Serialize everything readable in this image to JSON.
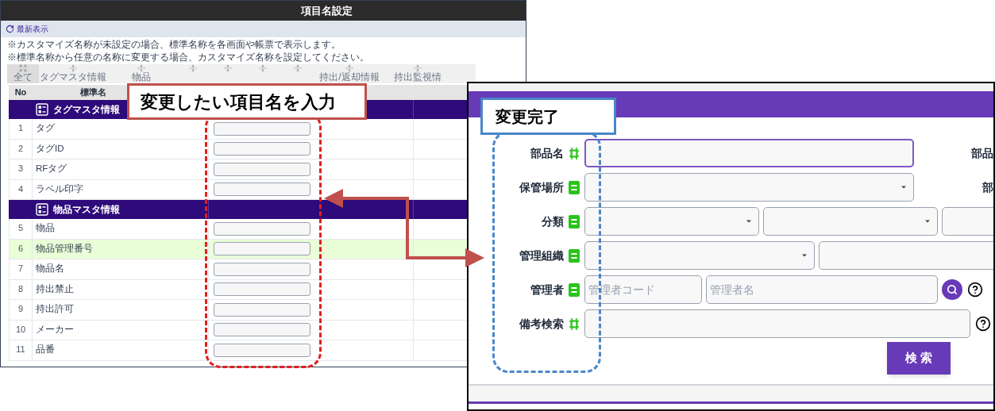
{
  "left_window": {
    "title": "項目名設定",
    "refresh": "最新表示",
    "notes": [
      "※カスタマイズ名称が未設定の場合、標準名称を各画面や帳票で表示します。",
      "※標準名称から任意の名称に変更する場合、カスタマイズ名称を設定してください。"
    ],
    "toolbar": [
      {
        "kind": "all",
        "label": "全て",
        "selected": true
      },
      {
        "kind": "section",
        "label": "タグマスタ情報",
        "selected": false
      },
      {
        "kind": "section",
        "label": "物品",
        "selected": false
      },
      {
        "kind": "section",
        "selected": false
      },
      {
        "kind": "section",
        "selected": false
      },
      {
        "kind": "section",
        "selected": false
      },
      {
        "kind": "section",
        "selected": false
      },
      {
        "kind": "section",
        "label": "持出/返却情報",
        "selected": false
      },
      {
        "kind": "section",
        "label": "持出監視情",
        "selected": false
      }
    ],
    "columns": [
      "No",
      "標準名"
    ],
    "groups": [
      {
        "title": "タグマスタ情報",
        "rows": [
          {
            "no": "1",
            "name": "タグ",
            "selected": false
          },
          {
            "no": "2",
            "name": "タグID",
            "selected": false
          },
          {
            "no": "3",
            "name": "RFタグ",
            "selected": false
          },
          {
            "no": "4",
            "name": "ラベル印字",
            "selected": false
          }
        ]
      },
      {
        "title": "物品マスタ情報",
        "rows": [
          {
            "no": "5",
            "name": "物品",
            "selected": false
          },
          {
            "no": "6",
            "name": "物品管理番号",
            "selected": true
          },
          {
            "no": "7",
            "name": "物品名",
            "selected": false
          },
          {
            "no": "8",
            "name": "持出禁止",
            "selected": false
          },
          {
            "no": "9",
            "name": "持出許可",
            "selected": false
          },
          {
            "no": "10",
            "name": "メーカー",
            "selected": false
          },
          {
            "no": "11",
            "name": "品番",
            "selected": false
          }
        ]
      }
    ]
  },
  "right_window": {
    "rows": [
      {
        "label": "部品名",
        "match": {
          "kind": "partial"
        },
        "fields": [
          {
            "kind": "input",
            "focused": true
          }
        ],
        "side_label": "部品"
      },
      {
        "label": "保管場所",
        "match": {
          "kind": "exact"
        },
        "fields": [
          {
            "kind": "select"
          }
        ],
        "side_label": "部"
      },
      {
        "label": "分類",
        "match": {
          "kind": "exact"
        },
        "fields": [
          {
            "kind": "select"
          },
          {
            "kind": "select"
          },
          {
            "kind": "input"
          }
        ]
      },
      {
        "label": "管理組織",
        "match": {
          "kind": "exact"
        },
        "fields": [
          {
            "kind": "select"
          },
          {
            "kind": "input"
          }
        ]
      },
      {
        "label": "管理者",
        "match": {
          "kind": "exact"
        },
        "fields": [
          {
            "kind": "input",
            "placeholder": "管理者コード"
          },
          {
            "kind": "input",
            "placeholder": "管理者名"
          }
        ],
        "actions": [
          {
            "kind": "search"
          },
          {
            "kind": "help"
          }
        ]
      },
      {
        "label": "備考検索",
        "match": {
          "kind": "partial"
        },
        "fields": [
          {
            "kind": "input"
          }
        ],
        "actions": [
          {
            "kind": "help"
          }
        ]
      }
    ],
    "search_button": "検 索"
  },
  "callouts": [
    {
      "text": "変更したい項目名を入力"
    },
    {
      "text": "変更完了"
    }
  ]
}
